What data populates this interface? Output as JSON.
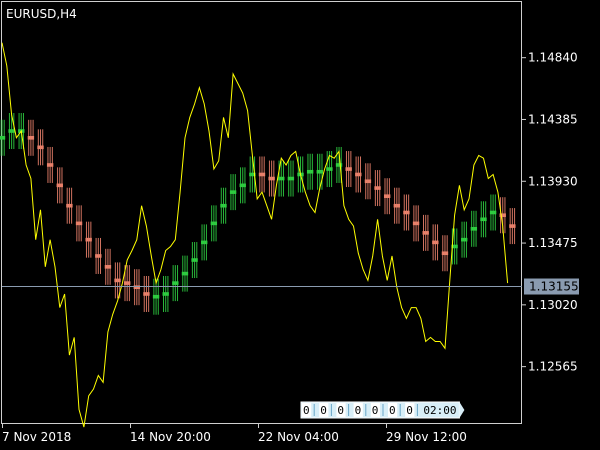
{
  "chart_data": {
    "type": "line",
    "symbol": "EURUSD,H4",
    "y_ticks": [
      "1.14840",
      "1.14385",
      "1.13930",
      "1.13475",
      "1.13020",
      "1.12565"
    ],
    "x_ticks": [
      "7 Nov 2018",
      "14 Nov 20:00",
      "22 Nov 04:00",
      "29 Nov 12:00"
    ],
    "current_price": "1.13155",
    "ylim": [
      1.1215,
      1.1525
    ],
    "x_bar_range": [
      0,
      108
    ],
    "series": [
      {
        "style": "line",
        "color": "#ffff00",
        "values": [
          [
            0,
            1.1495
          ],
          [
            1,
            1.1478
          ],
          [
            2,
            1.1442
          ],
          [
            3,
            1.1425
          ],
          [
            4,
            1.143
          ],
          [
            5,
            1.1405
          ],
          [
            6,
            1.1395
          ],
          [
            7,
            1.135
          ],
          [
            8,
            1.1372
          ],
          [
            9,
            1.133
          ],
          [
            10,
            1.135
          ],
          [
            11,
            1.133
          ],
          [
            12,
            1.13
          ],
          [
            13,
            1.131
          ],
          [
            14,
            1.1265
          ],
          [
            15,
            1.1278
          ],
          [
            16,
            1.1225
          ],
          [
            17,
            1.1212
          ],
          [
            18,
            1.1235
          ],
          [
            19,
            1.124
          ],
          [
            20,
            1.125
          ],
          [
            21,
            1.1245
          ],
          [
            22,
            1.1282
          ],
          [
            23,
            1.1295
          ],
          [
            24,
            1.1305
          ],
          [
            25,
            1.1318
          ],
          [
            26,
            1.1335
          ],
          [
            27,
            1.1342
          ],
          [
            28,
            1.135
          ],
          [
            29,
            1.1375
          ],
          [
            30,
            1.136
          ],
          [
            31,
            1.1338
          ],
          [
            32,
            1.1318
          ],
          [
            33,
            1.1328
          ],
          [
            34,
            1.1342
          ],
          [
            35,
            1.1345
          ],
          [
            36,
            1.135
          ],
          [
            37,
            1.1385
          ],
          [
            38,
            1.1425
          ],
          [
            39,
            1.144
          ],
          [
            40,
            1.145
          ],
          [
            41,
            1.1462
          ],
          [
            42,
            1.145
          ],
          [
            43,
            1.143
          ],
          [
            44,
            1.1402
          ],
          [
            45,
            1.1408
          ],
          [
            46,
            1.144
          ],
          [
            47,
            1.1425
          ],
          [
            48,
            1.1472
          ],
          [
            49,
            1.1465
          ],
          [
            50,
            1.1458
          ],
          [
            51,
            1.1445
          ],
          [
            52,
            1.1412
          ],
          [
            53,
            1.138
          ],
          [
            54,
            1.1385
          ],
          [
            55,
            1.1375
          ],
          [
            56,
            1.1365
          ],
          [
            57,
            1.139
          ],
          [
            58,
            1.141
          ],
          [
            59,
            1.1405
          ],
          [
            60,
            1.1412
          ],
          [
            61,
            1.1415
          ],
          [
            62,
            1.1398
          ],
          [
            63,
            1.1385
          ],
          [
            64,
            1.1375
          ],
          [
            65,
            1.137
          ],
          [
            66,
            1.1388
          ],
          [
            67,
            1.1402
          ],
          [
            68,
            1.1412
          ],
          [
            69,
            1.141
          ],
          [
            70,
            1.1415
          ],
          [
            71,
            1.1375
          ],
          [
            72,
            1.1365
          ],
          [
            73,
            1.136
          ],
          [
            74,
            1.134
          ],
          [
            75,
            1.1328
          ],
          [
            76,
            1.132
          ],
          [
            77,
            1.1338
          ],
          [
            78,
            1.1365
          ],
          [
            79,
            1.1338
          ],
          [
            80,
            1.132
          ],
          [
            81,
            1.1338
          ],
          [
            82,
            1.1315
          ],
          [
            83,
            1.13
          ],
          [
            84,
            1.1292
          ],
          [
            85,
            1.13
          ],
          [
            86,
            1.13
          ],
          [
            87,
            1.1292
          ],
          [
            88,
            1.1275
          ],
          [
            89,
            1.1278
          ],
          [
            90,
            1.1275
          ],
          [
            91,
            1.1275
          ],
          [
            92,
            1.127
          ],
          [
            93,
            1.132
          ],
          [
            94,
            1.1368
          ],
          [
            95,
            1.139
          ],
          [
            96,
            1.1372
          ],
          [
            97,
            1.138
          ],
          [
            98,
            1.1405
          ],
          [
            99,
            1.1412
          ],
          [
            100,
            1.141
          ],
          [
            101,
            1.1395
          ],
          [
            102,
            1.1398
          ],
          [
            103,
            1.1385
          ],
          [
            104,
            1.136
          ],
          [
            105,
            1.1318
          ]
        ]
      },
      {
        "style": "ribbon",
        "up_color": "#2ecc40",
        "down_color": "#e8806a",
        "values": [
          [
            0,
            1.1425,
            1
          ],
          [
            2,
            1.143,
            1
          ],
          [
            4,
            1.143,
            1
          ],
          [
            6,
            1.1425,
            -1
          ],
          [
            8,
            1.1418,
            -1
          ],
          [
            10,
            1.1405,
            -1
          ],
          [
            12,
            1.139,
            -1
          ],
          [
            14,
            1.1375,
            -1
          ],
          [
            16,
            1.1362,
            -1
          ],
          [
            18,
            1.135,
            -1
          ],
          [
            20,
            1.1338,
            -1
          ],
          [
            22,
            1.133,
            -1
          ],
          [
            24,
            1.132,
            -1
          ],
          [
            26,
            1.1318,
            -1
          ],
          [
            28,
            1.1315,
            -1
          ],
          [
            30,
            1.131,
            -1
          ],
          [
            32,
            1.1308,
            1
          ],
          [
            34,
            1.131,
            1
          ],
          [
            36,
            1.1318,
            1
          ],
          [
            38,
            1.1325,
            1
          ],
          [
            40,
            1.1335,
            1
          ],
          [
            42,
            1.1348,
            1
          ],
          [
            44,
            1.1362,
            1
          ],
          [
            46,
            1.1375,
            1
          ],
          [
            48,
            1.1385,
            1
          ],
          [
            50,
            1.139,
            1
          ],
          [
            52,
            1.1398,
            1
          ],
          [
            54,
            1.1398,
            -1
          ],
          [
            56,
            1.1395,
            -1
          ],
          [
            58,
            1.1395,
            1
          ],
          [
            60,
            1.1395,
            1
          ],
          [
            62,
            1.1398,
            1
          ],
          [
            64,
            1.14,
            1
          ],
          [
            66,
            1.14,
            1
          ],
          [
            68,
            1.1402,
            1
          ],
          [
            70,
            1.1405,
            1
          ],
          [
            72,
            1.1402,
            -1
          ],
          [
            74,
            1.1398,
            -1
          ],
          [
            76,
            1.1393,
            -1
          ],
          [
            78,
            1.1388,
            -1
          ],
          [
            80,
            1.1382,
            -1
          ],
          [
            82,
            1.1375,
            -1
          ],
          [
            84,
            1.137,
            -1
          ],
          [
            86,
            1.1362,
            -1
          ],
          [
            88,
            1.1355,
            -1
          ],
          [
            90,
            1.1348,
            -1
          ],
          [
            92,
            1.134,
            -1
          ],
          [
            94,
            1.1345,
            1
          ],
          [
            96,
            1.135,
            1
          ],
          [
            98,
            1.1358,
            1
          ],
          [
            100,
            1.1365,
            1
          ],
          [
            102,
            1.137,
            1
          ],
          [
            104,
            1.1368,
            -1
          ],
          [
            106,
            1.136,
            -1
          ]
        ]
      }
    ],
    "grid": false,
    "legend": "none"
  },
  "timeframe_box": {
    "segments": [
      "0",
      "0",
      "0",
      "0",
      "0",
      "0",
      "0"
    ],
    "label": "02:00"
  }
}
